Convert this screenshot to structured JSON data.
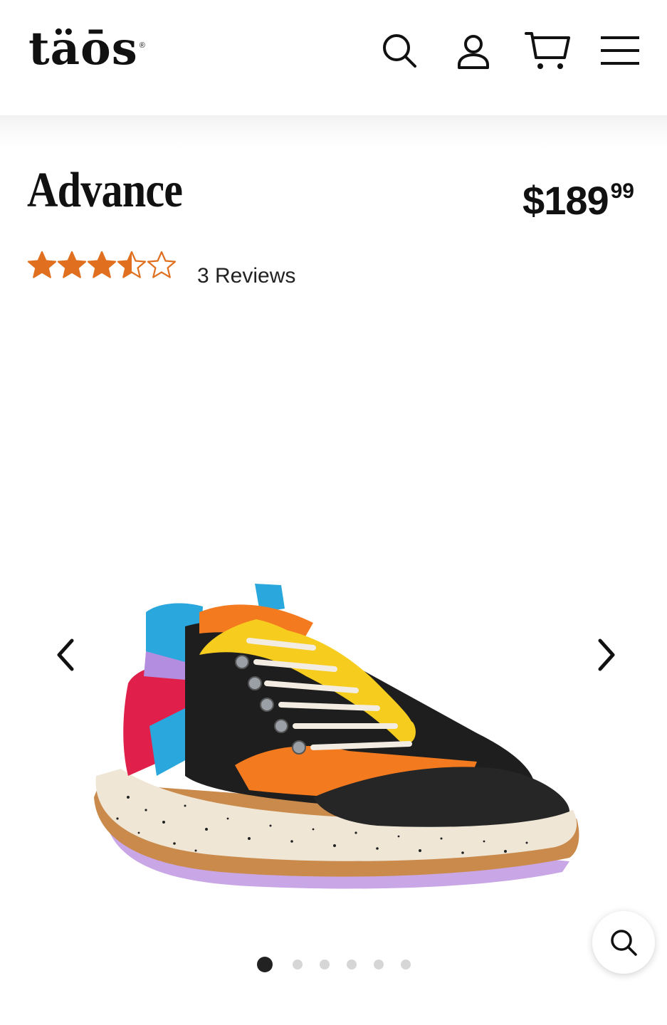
{
  "header": {
    "logo_text": "täōs",
    "logo_mark": "®",
    "icons": [
      "search-icon",
      "account-icon",
      "cart-icon",
      "menu-icon"
    ]
  },
  "product": {
    "title": "Advance",
    "price_dollars": "$189",
    "price_cents": "99",
    "rating": 3.5,
    "rating_max": 5,
    "reviews_label": "3 Reviews"
  },
  "gallery": {
    "image_count": 6,
    "active_index": 0,
    "icons": [
      "chevron-left-icon",
      "chevron-right-icon",
      "zoom-icon"
    ]
  },
  "colors": {
    "star": "#e0701f",
    "text": "#111111",
    "dot_active": "#222222",
    "dot_inactive": "#d6d6d6"
  }
}
